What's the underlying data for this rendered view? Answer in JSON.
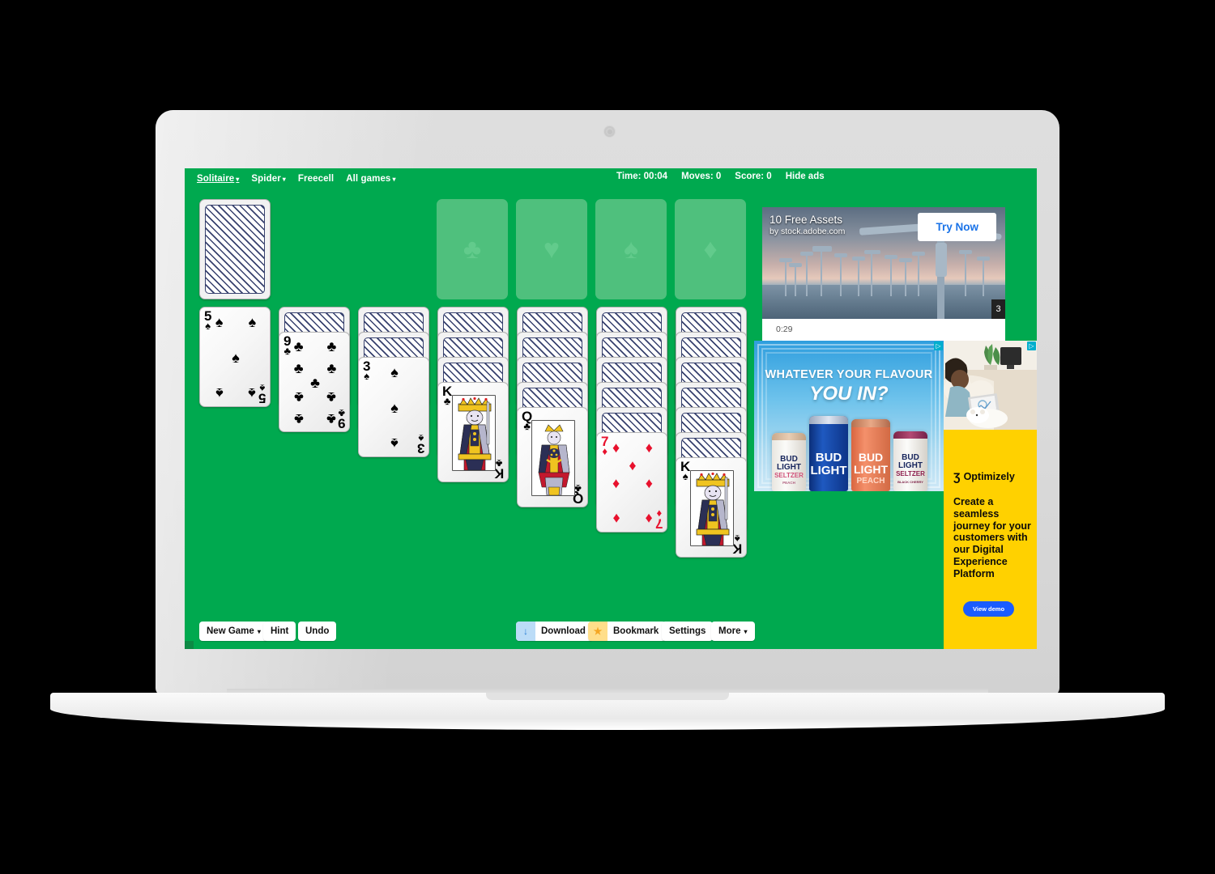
{
  "app": {
    "name": "Solitaire",
    "background_color": "#00A94F",
    "device": "laptop"
  },
  "topnav": {
    "items": [
      {
        "label": "Solitaire",
        "caret": "▾",
        "active": true
      },
      {
        "label": "Spider",
        "caret": "▾",
        "active": false
      },
      {
        "label": "Freecell",
        "caret": "",
        "active": false
      },
      {
        "label": "All games",
        "caret": "▾",
        "active": false
      }
    ],
    "status": {
      "time": "Time: 00:04",
      "moves": "Moves: 0",
      "score": "Score: 0",
      "hide_ads": "Hide ads"
    }
  },
  "board": {
    "stock": {
      "face_down": true
    },
    "waste": {
      "empty": true
    },
    "foundations": [
      {
        "suit": "clubs",
        "glyph": "♣",
        "empty": true
      },
      {
        "suit": "hearts",
        "glyph": "♥",
        "empty": true
      },
      {
        "suit": "spades",
        "glyph": "♠",
        "empty": true
      },
      {
        "suit": "diamonds",
        "glyph": "♦",
        "empty": true
      }
    ],
    "tableau": [
      {
        "index": 1,
        "face_down": 0,
        "top_card": {
          "rank": "5",
          "suit": "spades",
          "glyph": "♠",
          "color": "black"
        }
      },
      {
        "index": 2,
        "face_down": 1,
        "top_card": {
          "rank": "9",
          "suit": "clubs",
          "glyph": "♣",
          "color": "black"
        }
      },
      {
        "index": 3,
        "face_down": 2,
        "top_card": {
          "rank": "3",
          "suit": "spades",
          "glyph": "♠",
          "color": "black"
        }
      },
      {
        "index": 4,
        "face_down": 3,
        "top_card": {
          "rank": "K",
          "suit": "clubs",
          "glyph": "♣",
          "color": "black"
        }
      },
      {
        "index": 5,
        "face_down": 4,
        "top_card": {
          "rank": "Q",
          "suit": "clubs",
          "glyph": "♣",
          "color": "black"
        }
      },
      {
        "index": 6,
        "face_down": 5,
        "top_card": {
          "rank": "7",
          "suit": "diamonds",
          "glyph": "♦",
          "color": "red"
        }
      },
      {
        "index": 7,
        "face_down": 6,
        "top_card": {
          "rank": "K",
          "suit": "spades",
          "glyph": "♠",
          "color": "black"
        }
      }
    ]
  },
  "toolbar": {
    "new_game": "New Game",
    "new_game_caret": "▾",
    "hint": "Hint",
    "undo": "Undo",
    "download": "Download",
    "download_icon": "↓",
    "bookmark": "Bookmark",
    "bookmark_icon": "★",
    "settings": "Settings",
    "more": "More",
    "more_caret": "▾"
  },
  "ads": {
    "video": {
      "headline": "10 Free Assets",
      "byline": "by stock.adobe.com",
      "cta": "Try Now",
      "timer": "0:29",
      "badge": "3"
    },
    "budlight": {
      "line1": "WHATEVER YOUR FLAVOUR",
      "line2": "YOU IN?",
      "adchoices": "▷",
      "cans": [
        {
          "brand": "BUD",
          "brand2": "LIGHT",
          "variant": "SELTZER",
          "flavour": "PEACH"
        },
        {
          "brand": "BUD",
          "brand2": "LIGHT",
          "variant": "",
          "flavour": ""
        },
        {
          "brand": "BUD",
          "brand2": "LIGHT",
          "variant": "",
          "flavour": "PEACH"
        },
        {
          "brand": "BUD",
          "brand2": "LIGHT",
          "variant": "SELTZER",
          "flavour": "BLACK CHERRY"
        }
      ]
    },
    "optimizely": {
      "brand": "Optimizely",
      "brand_mark": "Ʒ",
      "copy": "Create a seamless journey for your customers with our Digital Experience Platform",
      "cta": "View demo",
      "adchoices": "▷",
      "bg_color": "#FFD100",
      "cta_color": "#1a5cff"
    }
  }
}
